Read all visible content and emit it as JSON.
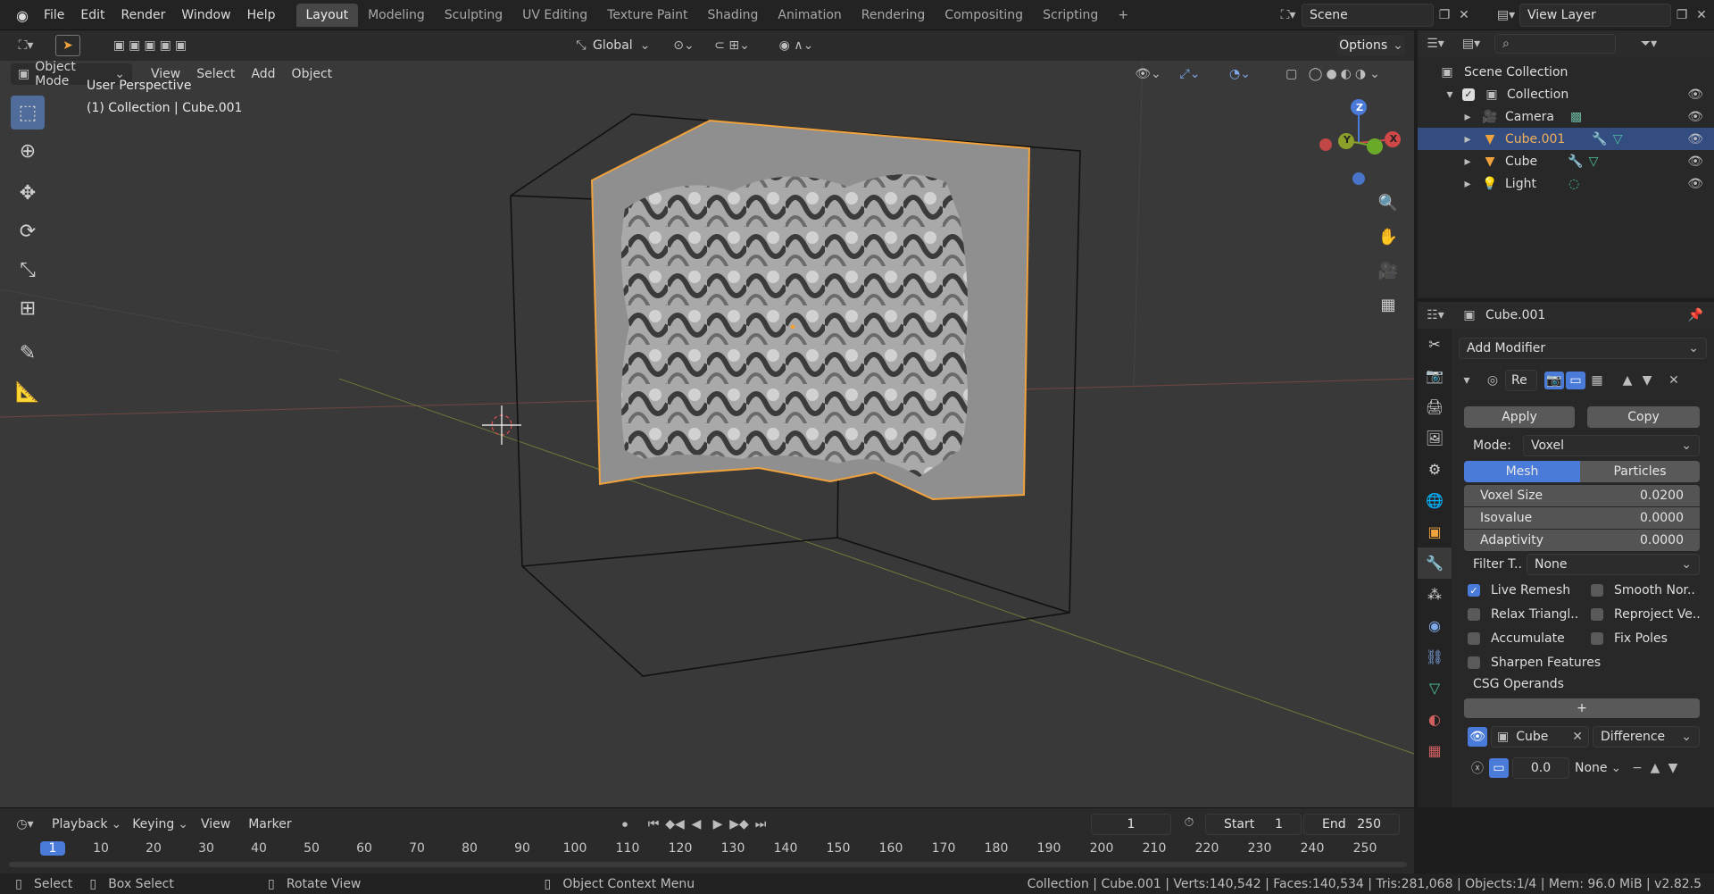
{
  "topbar": {
    "menu": [
      "File",
      "Edit",
      "Render",
      "Window",
      "Help"
    ],
    "workspaces": [
      "Layout",
      "Modeling",
      "Sculpting",
      "UV Editing",
      "Texture Paint",
      "Shading",
      "Animation",
      "Rendering",
      "Compositing",
      "Scripting"
    ],
    "add_tab": "+",
    "scene": "Scene",
    "view_layer": "View Layer"
  },
  "viewport": {
    "mode": "Object Mode",
    "menus": [
      "View",
      "Select",
      "Add",
      "Object"
    ],
    "transform": "Global",
    "options": "Options",
    "overlay_title": "User Perspective",
    "overlay_sub": "(1) Collection | Cube.001",
    "gizmo": {
      "z": "Z",
      "y": "Y",
      "x": "X"
    }
  },
  "outliner": {
    "search_placeholder": "",
    "items": [
      {
        "name": "Scene Collection",
        "level": 0
      },
      {
        "name": "Collection",
        "level": 1
      },
      {
        "name": "Camera",
        "level": 2
      },
      {
        "name": "Cube.001",
        "level": 2,
        "selected": true
      },
      {
        "name": "Cube",
        "level": 2
      },
      {
        "name": "Light",
        "level": 2
      }
    ]
  },
  "properties": {
    "object": "Cube.001",
    "add_modifier": "Add Modifier",
    "mod_name": "Re",
    "apply": "Apply",
    "copy": "Copy",
    "mode_label": "Mode:",
    "mode_value": "Voxel",
    "tab_mesh": "Mesh",
    "tab_particles": "Particles",
    "voxel_size_label": "Voxel Size",
    "voxel_size": "0.0200",
    "isovalue_label": "Isovalue",
    "isovalue": "0.0000",
    "adaptivity_label": "Adaptivity",
    "adaptivity": "0.0000",
    "filter_label": "Filter T..",
    "filter_value": "None",
    "checks": [
      {
        "label": "Live Remesh",
        "on": true
      },
      {
        "label": "Smooth Nor..",
        "on": false
      },
      {
        "label": "Relax Triangl..",
        "on": false
      },
      {
        "label": "Reproject Ve..",
        "on": false
      },
      {
        "label": "Accumulate",
        "on": false
      },
      {
        "label": "Fix Poles",
        "on": false
      },
      {
        "label": "Sharpen Features",
        "on": false
      }
    ],
    "csg_label": "CSG Operands",
    "csg_add": "+",
    "operand_name": "Cube",
    "operand_op": "Difference",
    "operand_value": "0.0",
    "operand_none": "None"
  },
  "timeline": {
    "menus": [
      "Playback",
      "Keying",
      "View",
      "Marker"
    ],
    "frame": "1",
    "start_label": "Start",
    "start": "1",
    "end_label": "End",
    "end": "250",
    "ticks": [
      "1",
      "10",
      "20",
      "30",
      "40",
      "50",
      "60",
      "70",
      "80",
      "90",
      "100",
      "110",
      "120",
      "130",
      "140",
      "150",
      "160",
      "170",
      "180",
      "190",
      "200",
      "210",
      "220",
      "230",
      "240",
      "250"
    ]
  },
  "status": {
    "select": "Select",
    "box_select": "Box Select",
    "rotate": "Rotate View",
    "context": "Object Context Menu",
    "stats": "Collection | Cube.001 | Verts:140,542 | Faces:140,534 | Tris:281,068 | Objects:1/4 | Mem: 96.0 MiB | v2.82.5"
  }
}
